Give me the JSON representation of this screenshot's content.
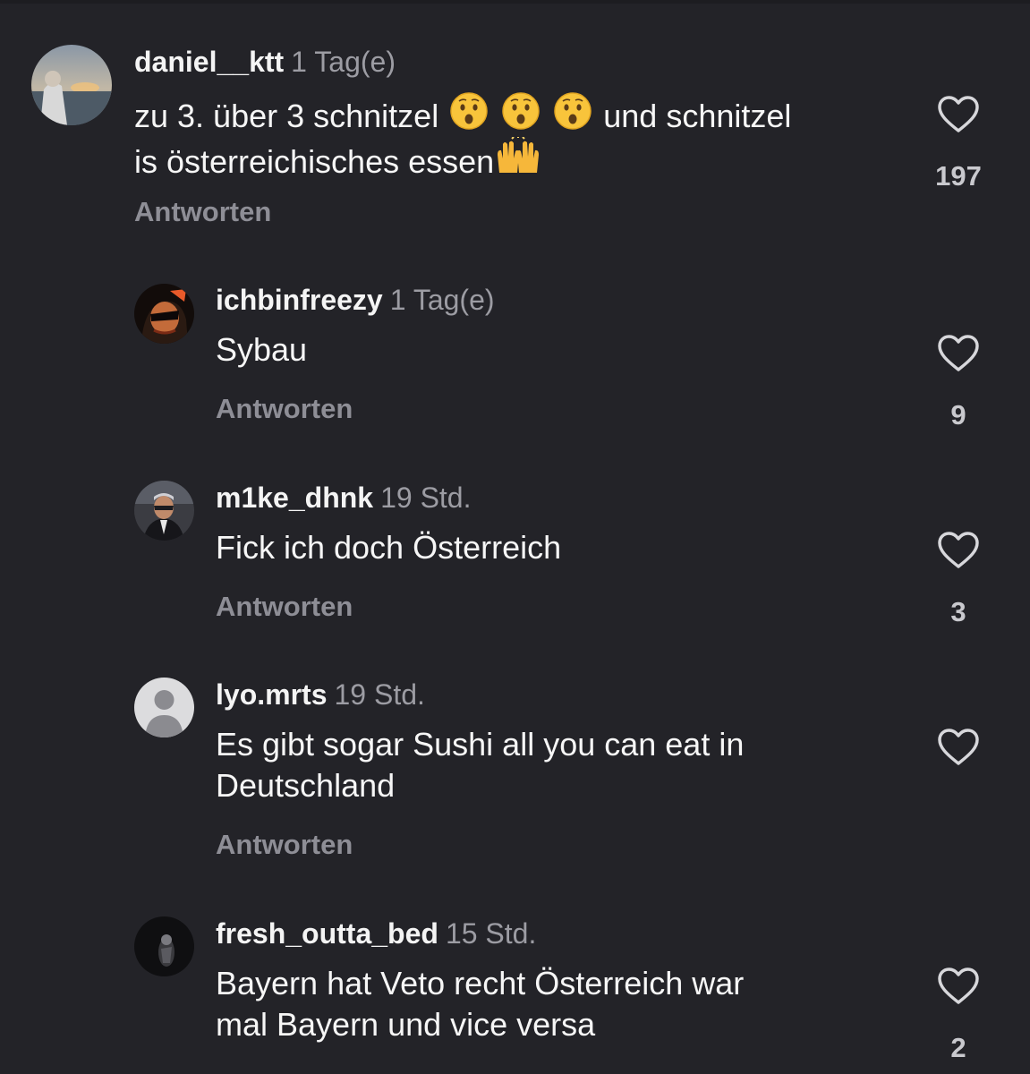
{
  "comments": [
    {
      "username": "daniel__ktt",
      "time": "1 Tag(e)",
      "text_part1": "zu 3. über 3 schnitzel",
      "text_part2": "und schnitzel",
      "text_line2": "is österreichisches essen",
      "emojis": [
        "hushed-face",
        "hushed-face",
        "hushed-face",
        "raising-hands"
      ],
      "reply_label": "Antworten",
      "likes": "197"
    },
    {
      "username": "ichbinfreezy",
      "time": "1 Tag(e)",
      "text": "Sybau",
      "reply_label": "Antworten",
      "likes": "9"
    },
    {
      "username": "m1ke_dhnk",
      "time": "19 Std.",
      "text": "Fick ich doch Österreich",
      "reply_label": "Antworten",
      "likes": "3"
    },
    {
      "username": "lyo.mrts",
      "time": "19 Std.",
      "text_line1": "Es gibt sogar Sushi all you can eat in",
      "text_line2": "Deutschland",
      "reply_label": "Antworten",
      "likes": ""
    },
    {
      "username": "fresh_outta_bed",
      "time": "15 Std.",
      "text_line1": "Bayern hat Veto recht Österreich war",
      "text_line2": "mal Bayern und vice versa",
      "reply_label": "",
      "likes": "2"
    }
  ],
  "colors": {
    "background": "#232328",
    "username": "#f4f4f4",
    "meta": "#9c9ca3",
    "reply": "#8e8e96",
    "heart": "#d7d7db"
  },
  "icons": [
    "heart-outline-icon",
    "default-avatar-icon"
  ]
}
